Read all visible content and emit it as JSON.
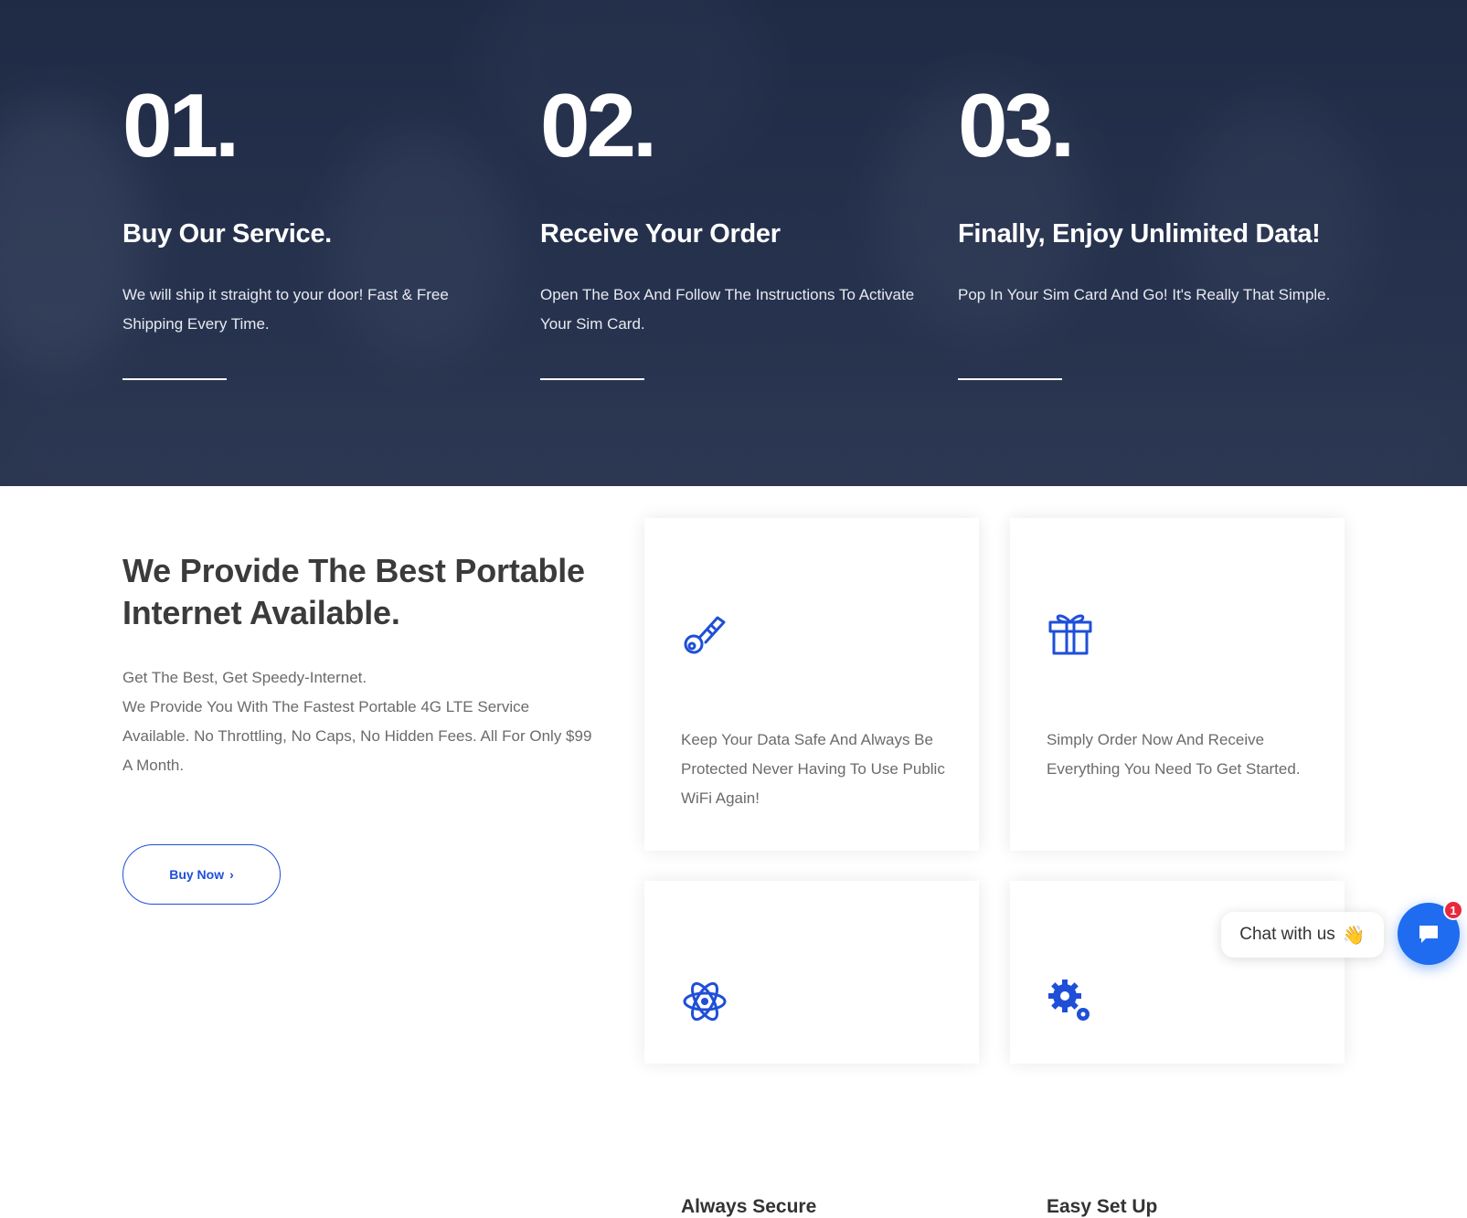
{
  "hero": {
    "steps": [
      {
        "number": "01.",
        "title": "Buy Our Service.",
        "text": "We will ship it straight to your door! Fast & Free Shipping Every Time."
      },
      {
        "number": "02.",
        "title": "Receive Your Order",
        "text": "Open The Box And Follow The Instructions To Activate Your Sim Card."
      },
      {
        "number": "03.",
        "title": "Finally, Enjoy Unlimited Data!",
        "text": "Pop In Your Sim Card And Go! It's Really That Simple."
      }
    ]
  },
  "intro": {
    "title": "We Provide The Best Portable Internet Available.",
    "line1": "Get The Best, Get Speedy-Internet.",
    "line2": "We Provide You With The Fastest Portable 4G LTE Service Available. No Throttling, No Caps, No Hidden Fees. All For Only $99 A Month.",
    "button_label": "Buy Now",
    "button_icon": "chevron-right-icon"
  },
  "features": [
    {
      "icon": "key-icon",
      "title": "Always Secure",
      "text": "Keep Your Data Safe And Always Be Protected Never Having To Use Public WiFi Again!"
    },
    {
      "icon": "gift-icon",
      "title": "Easy Set Up",
      "text": "Simply Order Now And Receive Everything You Need To Get Started."
    },
    {
      "icon": "atom-icon",
      "title": "",
      "text": ""
    },
    {
      "icon": "gears-icon",
      "title": "",
      "text": ""
    }
  ],
  "chat": {
    "label": "Chat with us",
    "badge_count": "1",
    "emoji": "👋"
  },
  "colors": {
    "accent": "#1f4fd8",
    "hero_bg": "#222d47",
    "chat_button": "#1f6cf0",
    "badge": "#e8283b"
  }
}
